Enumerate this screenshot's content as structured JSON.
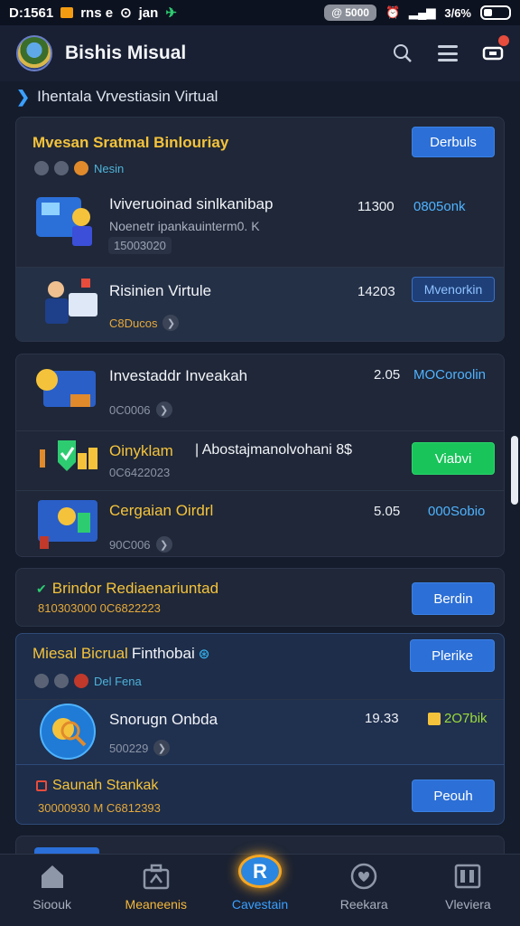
{
  "status_bar": {
    "time": "D:1561",
    "left_text": "rns e",
    "left_text2": "jan",
    "pill": "@ 5000",
    "signal_pct": "3/6%"
  },
  "app_bar": {
    "title": "Bishis Misual"
  },
  "section": {
    "title": "Ihentala Vrvestiasin Virtual"
  },
  "card1": {
    "title": "Mvesan Sratmal Binlouriay",
    "button": "Derbuls",
    "sub_label": "Nesin",
    "rows": [
      {
        "name": "Iviveruoinad sinlkanibap",
        "desc": "Noenetr ipankauinterm0. K",
        "code": "15003020",
        "num": "11300",
        "link": "0805onk"
      },
      {
        "name": "Risinien Virtule",
        "code": "C8Ducos",
        "num": "14203",
        "link": "Mvenorkin"
      }
    ]
  },
  "card2": {
    "rows": [
      {
        "name": "Investaddr Inveakah",
        "code": "0C0006",
        "num": "2.05",
        "link": "MOCoroolin"
      },
      {
        "name": "Oinyklam",
        "name2": "| Abostajmanolvohani 8$",
        "code": "0C6422023",
        "button": "Viabvi"
      },
      {
        "name": "Cergaian Oirdrl",
        "code": "90C006",
        "num": "5.05",
        "link": "000Sobio"
      }
    ]
  },
  "card3": {
    "title": "Brindor Rediaenariuntad",
    "code": "810303000 0C6822223",
    "button": "Berdin"
  },
  "card4": {
    "title": "Miesal Bicrual",
    "title2": "Finthobai",
    "button": "Plerike",
    "sub_label": "Del Fena",
    "row": {
      "name": "Snorugn Onbda",
      "code": "500229",
      "num": "19.33",
      "link": "2O7bik"
    },
    "bottom_title": "Saunah Stankak",
    "bottom_code": "30000930 M C6812393",
    "bottom_button": "Peouh"
  },
  "bottom_nav": [
    {
      "label": "Sioouk",
      "icon": "home-icon"
    },
    {
      "label": "Meaneenis",
      "icon": "briefcase-icon"
    },
    {
      "label": "Cavestain",
      "icon": "invest-icon"
    },
    {
      "label": "Reekara",
      "icon": "heart-icon"
    },
    {
      "label": "Vleviera",
      "icon": "view-icon"
    }
  ],
  "colors": {
    "background": "#151c2c",
    "accent_blue": "#2c6fd6",
    "accent_yellow": "#f5c33b",
    "accent_green": "#19c45a"
  }
}
